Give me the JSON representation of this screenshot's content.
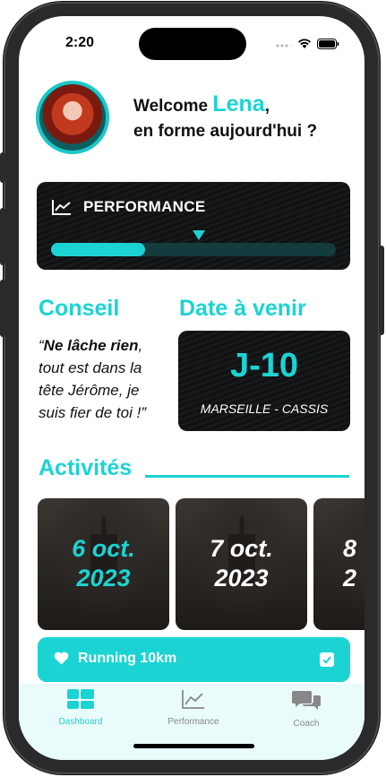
{
  "status": {
    "time": "2:20"
  },
  "header": {
    "welcome_prefix": "Welcome ",
    "user_name": "Lena",
    "welcome_suffix": ",",
    "subtitle": "en forme aujourd'hui ?"
  },
  "performance": {
    "title": "PERFORMANCE",
    "progress": 0.33,
    "marker": 0.52
  },
  "conseil": {
    "heading": "Conseil",
    "quote_open": "“",
    "quote_bold": "Ne lâche rien",
    "quote_rest": ", tout est dans la tête Jérôme, je suis fier de toi !”"
  },
  "date_a_venir": {
    "heading": "Date à venir",
    "countdown": "J-10",
    "place": "MARSEILLE - CASSIS"
  },
  "activites": {
    "heading": "Activités",
    "cards": [
      {
        "day": "6 oct.",
        "year": "2023",
        "accent": true
      },
      {
        "day": "7 oct.",
        "year": "2023",
        "accent": false
      },
      {
        "day": "8",
        "year": "2",
        "accent": false
      }
    ]
  },
  "selected_activity": {
    "label": "Running 10km",
    "checked": true
  },
  "tabbar": {
    "items": [
      {
        "label": "Dashboard",
        "active": true
      },
      {
        "label": "Performance",
        "active": false
      },
      {
        "label": "Coach",
        "active": false
      }
    ]
  },
  "colors": {
    "accent": "#1cd3d3",
    "dark_card": "#131517",
    "tabbar_bg": "#e9fbfb"
  }
}
